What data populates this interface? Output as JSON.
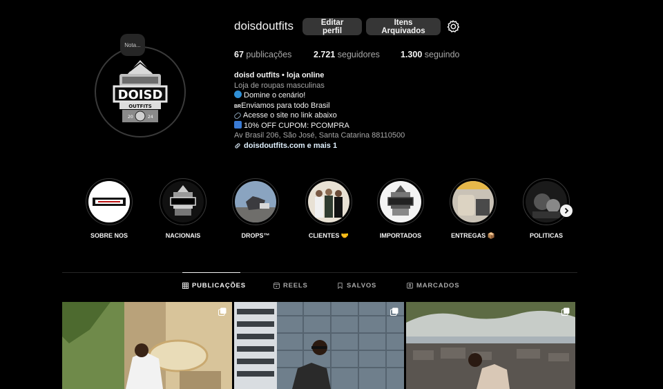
{
  "profile": {
    "username": "doisdoutfits",
    "note": "Nota...",
    "edit_button": "Editar perfil",
    "archive_button": "Itens Arquivados",
    "settings_icon": "gear-icon"
  },
  "stats": {
    "posts_count": "67",
    "posts_label": "publicações",
    "followers_count": "2.721",
    "followers_label": "seguidores",
    "following_count": "1.300",
    "following_label": "seguindo"
  },
  "bio": {
    "name": "doisd outfits • loja online",
    "category": "Loja de roupas masculinas",
    "line1": "Domine o cenário!",
    "line2_prefix": "BR",
    "line2": "Enviamos para todo Brasil",
    "line3": "Acesse o site no link abaixo",
    "line4": "10% OFF CUPOM: PCOMPRA",
    "address": "Av Brasil 206, São José, Santa Catarina 88110500",
    "link": "doisdoutfits.com e mais 1"
  },
  "highlights": [
    {
      "label": "SOBRE NOS"
    },
    {
      "label": "NACIONAIS"
    },
    {
      "label": "DROPS™"
    },
    {
      "label": "CLIENTES 🤝"
    },
    {
      "label": "IMPORTADOS"
    },
    {
      "label": "ENTREGAS 📦"
    },
    {
      "label": "POLITICAS"
    }
  ],
  "tabs": [
    {
      "label": "PUBLICAÇÕES",
      "icon": "grid-icon",
      "active": true
    },
    {
      "label": "REELS",
      "icon": "reels-icon",
      "active": false
    },
    {
      "label": "SALVOS",
      "icon": "bookmark-icon",
      "active": false
    },
    {
      "label": "MARCADOS",
      "icon": "tagged-icon",
      "active": false
    }
  ],
  "colors": {
    "background": "#000000",
    "button_bg": "#363636",
    "muted_text": "#a8a8a8",
    "link_text": "#e0f1ff"
  }
}
